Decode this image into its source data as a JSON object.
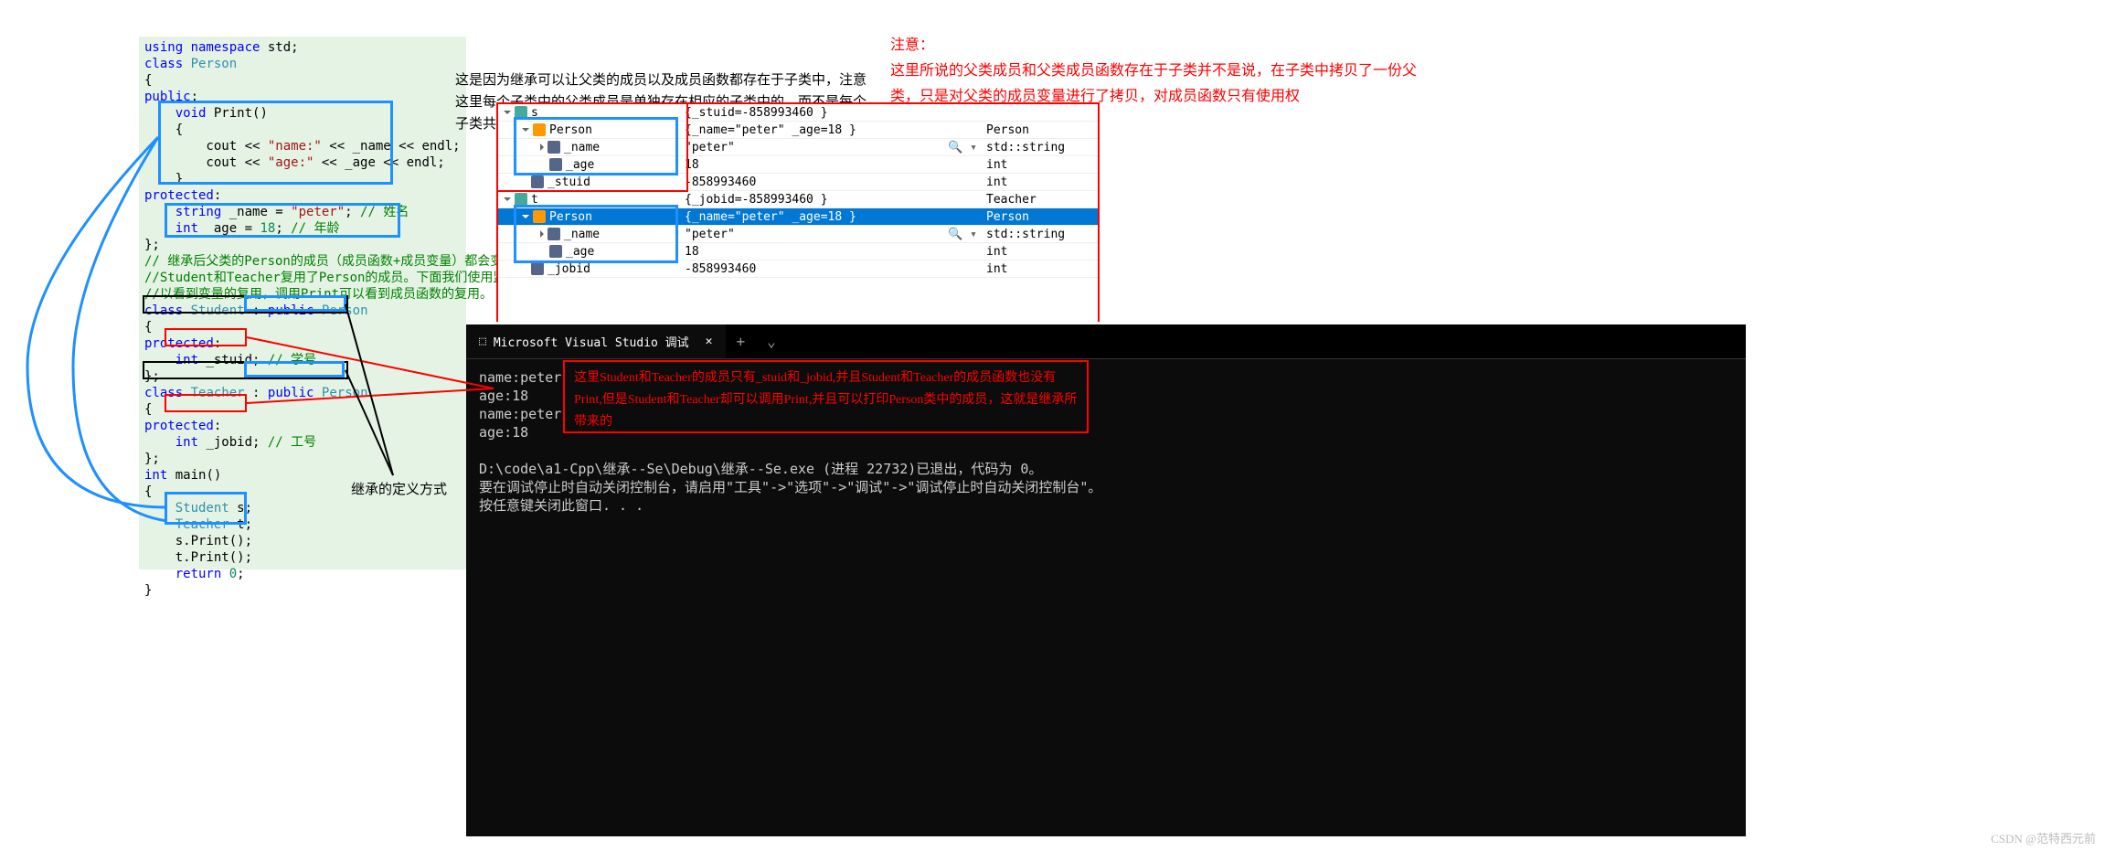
{
  "code": {
    "l1": "using namespace std;",
    "l2": "class Person",
    "l3": "{",
    "l4": "public:",
    "l5": "    void Print()",
    "l6": "    {",
    "l7a": "        cout << ",
    "l7s1": "\"name:\"",
    "l7b": " << _name << endl;",
    "l8a": "        cout << ",
    "l8s1": "\"age:\"",
    "l8b": " << _age << endl;",
    "l9": "    }",
    "l10": "protected:",
    "l11a": "    string _name = ",
    "l11s": "\"peter\"",
    "l11b": "; ",
    "l11c": "// 姓名",
    "l12a": "    int _age = 18; ",
    "l12c": "// 年龄",
    "l13": "};",
    "l14": "// 继承后父类的Person的成员（成员函数+成员变量）都会变成子",
    "l15": "//Student和Teacher复用了Person的成员。下面我们使用监视窗口",
    "l16": "//以看到变量的复用，调用Print可以看到成员函数的复用。",
    "l17": "class Student : public Person",
    "l18": "{",
    "l19": "protected:",
    "l20a": "    int _stuid;",
    "l20c": " // 学号",
    "l21": "};",
    "l22": "class Teacher : public Person",
    "l23": "{",
    "l24": "protected:",
    "l25a": "    int _jobid;",
    "l25c": " // 工号",
    "l26": "};",
    "l27": "int main()",
    "l28": "{",
    "l29": "    Student s;",
    "l30": "    Teacher t;",
    "l31": "    s.Print();",
    "l32": "    t.Print();",
    "l33": "    return 0;",
    "l34": "}"
  },
  "desc": "这是因为继承可以让父类的成员以及成员函数都存在于子类中，注意这里每个子类中的父类成员是单独存在相应的子类中的，而不是每个子类共用一份父类成员",
  "note": "注意：\n这里所说的父类成员和父类成员函数存在于子类并不是说，在子类中拷贝了一份父类，只是对父类的成员变量进行了拷贝，对成员函数只有使用权",
  "watch": {
    "rows": [
      {
        "n": "s",
        "v": "{_stuid=-858993460 }",
        "t": ""
      },
      {
        "n": "Person",
        "v": "{_name=\"peter\" _age=18 }",
        "t": "Person"
      },
      {
        "n": "_name",
        "v": "\"peter\"",
        "t": "std::string"
      },
      {
        "n": "_age",
        "v": "18",
        "t": "int"
      },
      {
        "n": "_stuid",
        "v": "-858993460",
        "t": "int"
      },
      {
        "n": "t",
        "v": "{_jobid=-858993460 }",
        "t": "Teacher"
      },
      {
        "n": "Person",
        "v": "{_name=\"peter\" _age=18 }",
        "t": "Person"
      },
      {
        "n": "_name",
        "v": "\"peter\"",
        "t": "std::string"
      },
      {
        "n": "_age",
        "v": "18",
        "t": "int"
      },
      {
        "n": "_jobid",
        "v": "-858993460",
        "t": "int"
      }
    ]
  },
  "term": {
    "tab": "Microsoft Visual Studio 调试",
    "out": "name:peter\nage:18\nname:peter\nage:18",
    "msg1": "D:\\code\\a1-Cpp\\继承--Se\\Debug\\继承--Se.exe (进程 22732)已退出，代码为 0。",
    "msg2": "要在调试停止时自动关闭控制台，请启用\"工具\"->\"选项\"->\"调试\"->\"调试停止时自动关闭控制台\"。",
    "msg3": "按任意键关闭此窗口. . ."
  },
  "redbox2": "这里Student和Teacher的成员只有_stuid和_jobid,并且Student和Teacher的成员函数也没有Print,但是Student和Teacher却可以调用Print,并且可以打印Person类中的成员，这就是继承所带来的",
  "label_inherit": "继承的定义方式",
  "watermark": "CSDN @范特西元前"
}
